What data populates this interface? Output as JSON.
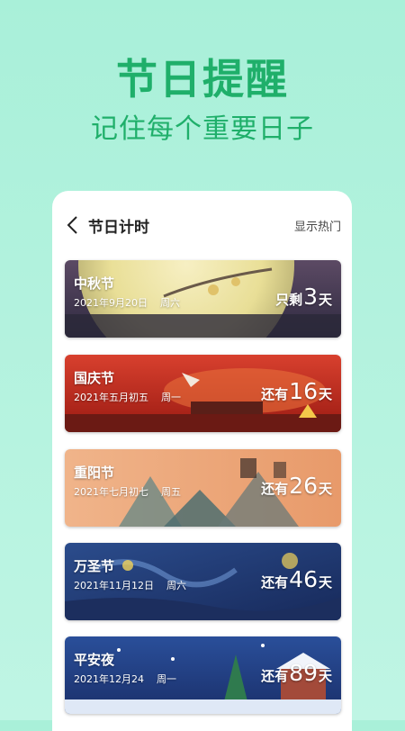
{
  "hero": {
    "title": "节日提醒",
    "subtitle": "记住每个重要日子"
  },
  "header": {
    "back_icon": "chevron-left-icon",
    "title": "节日计时",
    "hot_label": "显示热门"
  },
  "festivals": [
    {
      "name": "中秋节",
      "date": "2021年9月20日",
      "weekday": "周六",
      "prefix": "只剩",
      "days": "3",
      "unit": "天"
    },
    {
      "name": "国庆节",
      "date": "2021年五月初五",
      "weekday": "周一",
      "prefix": "还有",
      "days": "16",
      "unit": "天"
    },
    {
      "name": "重阳节",
      "date": "2021年七月初七",
      "weekday": "周五",
      "prefix": "还有",
      "days": "26",
      "unit": "天"
    },
    {
      "name": "万圣节",
      "date": "2021年11月12日",
      "weekday": "周六",
      "prefix": "还有",
      "days": "46",
      "unit": "天"
    },
    {
      "name": "平安夜",
      "date": "2021年12月24",
      "weekday": "周一",
      "prefix": "还有",
      "days": "89",
      "unit": "天"
    }
  ],
  "colors": {
    "accent": "#1faf6a",
    "background": "#abf0da"
  }
}
